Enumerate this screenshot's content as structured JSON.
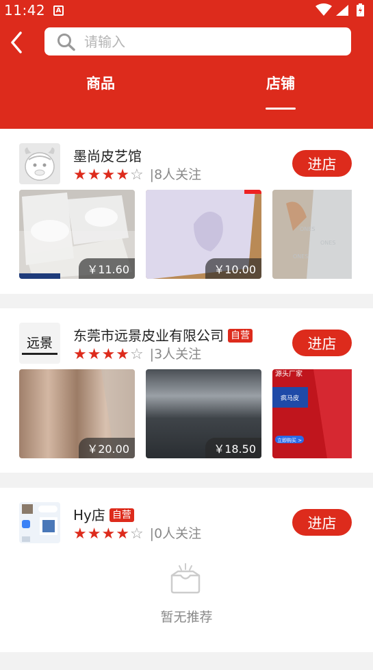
{
  "status_bar": {
    "time": "11:42",
    "app_icon_letter": "A"
  },
  "search": {
    "placeholder": "请输入"
  },
  "tabs": [
    {
      "label": "商品"
    },
    {
      "label": "店铺",
      "active": true
    }
  ],
  "theme": {
    "accent": "#dd2b1c",
    "background": "#f2f2f2"
  },
  "shops": [
    {
      "name": "墨尚皮艺馆",
      "badge": "",
      "rating": 4,
      "rating_max": 5,
      "followers": "|8人关注",
      "enter_label": "进店",
      "products": [
        {
          "price": "￥11.60"
        },
        {
          "price": "￥10.00"
        },
        {
          "price": "￥"
        }
      ]
    },
    {
      "name": "东莞市远景皮业有限公司",
      "badge": "自营",
      "logo_text": "远景",
      "rating": 4,
      "rating_max": 5,
      "followers": "|3人关注",
      "enter_label": "进店",
      "products": [
        {
          "price": "￥20.00"
        },
        {
          "price": "￥18.50"
        },
        {
          "price": "￥",
          "overlay_top": "源头厂家",
          "overlay_label": "疯马皮",
          "overlay_button": "立即购买 >"
        }
      ]
    },
    {
      "name": "Hy店",
      "badge": "自营",
      "rating": 4,
      "rating_max": 5,
      "followers": "|0人关注",
      "enter_label": "进店",
      "products": [],
      "empty_text": "暂无推荐"
    }
  ]
}
